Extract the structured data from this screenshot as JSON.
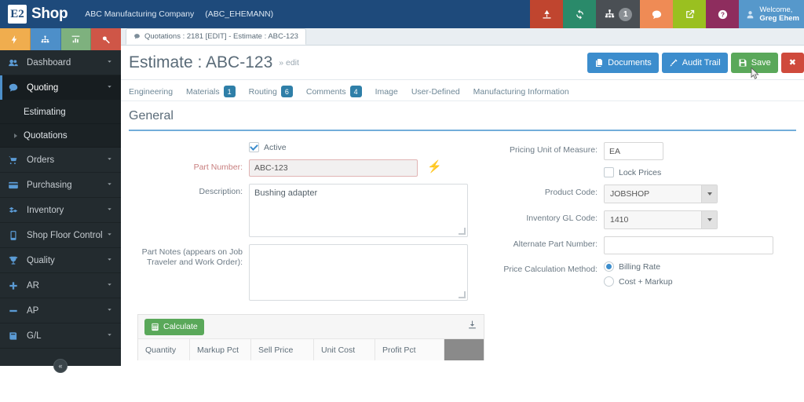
{
  "header": {
    "brand_mark": "E2",
    "brand_name": "Shop",
    "company_name": "ABC Manufacturing Company",
    "company_code": "(ABC_EHEMANN)",
    "welcome_line1": "Welcome,",
    "welcome_line2": "Greg Ehem",
    "actions": [
      {
        "name": "alerts-icon",
        "color": "#c0452f"
      },
      {
        "name": "sync-icon",
        "color": "#2a8a6a"
      },
      {
        "name": "org-chart-icon",
        "color": "#4a4f54",
        "badge": "1"
      },
      {
        "name": "chat-icon",
        "color": "#ef8b55"
      },
      {
        "name": "launch-icon",
        "color": "#9ac020"
      },
      {
        "name": "help-icon",
        "color": "#8e2d5e"
      }
    ]
  },
  "sidebar": {
    "quick_actions": [
      {
        "name": "bolt-icon",
        "color": "#f0ad4e"
      },
      {
        "name": "sitemap-icon",
        "color": "#4d8fc9"
      },
      {
        "name": "chart-icon",
        "color": "#7eb17e"
      },
      {
        "name": "tools-icon",
        "color": "#cf5647"
      }
    ],
    "items": [
      {
        "label": "Dashboard",
        "icon": "dashboard-icon",
        "active": false
      },
      {
        "label": "Quoting",
        "icon": "quoting-icon",
        "active": true
      },
      {
        "label": "Orders",
        "icon": "cart-icon",
        "active": false
      },
      {
        "label": "Purchasing",
        "icon": "card-icon",
        "active": false
      },
      {
        "label": "Inventory",
        "icon": "boxes-icon",
        "active": false
      },
      {
        "label": "Shop Floor Control",
        "icon": "tablet-icon",
        "active": false
      },
      {
        "label": "Quality",
        "icon": "trophy-icon",
        "active": false
      },
      {
        "label": "AR",
        "icon": "plus-icon",
        "active": false
      },
      {
        "label": "AP",
        "icon": "minus-icon",
        "active": false
      },
      {
        "label": "G/L",
        "icon": "book-icon",
        "active": false
      }
    ],
    "sub_items": [
      {
        "label": "Estimating",
        "has_caret": false
      },
      {
        "label": "Quotations",
        "has_caret": true
      }
    ],
    "collapse_glyph": "«"
  },
  "document_tab": {
    "label": "Quotations : 2181 [EDIT] - Estimate : ABC-123"
  },
  "page": {
    "title": "Estimate : ABC-123",
    "edit_suffix": "» edit",
    "actions": [
      {
        "label": "Documents",
        "icon": "documents-icon",
        "style": "blue"
      },
      {
        "label": "Audit Trail",
        "icon": "audit-icon",
        "style": "blue"
      },
      {
        "label": "Save",
        "icon": "save-icon",
        "style": "green"
      },
      {
        "label": "✖",
        "icon": "close-icon",
        "style": "red"
      }
    ]
  },
  "subtabs": [
    {
      "label": "Engineering",
      "badge": null
    },
    {
      "label": "Materials",
      "badge": "1"
    },
    {
      "label": "Routing",
      "badge": "6"
    },
    {
      "label": "Comments",
      "badge": "4"
    },
    {
      "label": "Image",
      "badge": null
    },
    {
      "label": "User-Defined",
      "badge": null
    },
    {
      "label": "Manufacturing Information",
      "badge": null
    }
  ],
  "section": {
    "title": "General"
  },
  "form_left": {
    "active_label": "Active",
    "active_checked": true,
    "part_number_label": "Part Number:",
    "part_number_value": "ABC-123",
    "description_label": "Description:",
    "description_value": "Bushing adapter",
    "part_notes_label": "Part Notes (appears on Job Traveler and Work Order):",
    "part_notes_value": ""
  },
  "form_right": {
    "pricing_uom_label": "Pricing Unit of Measure:",
    "pricing_uom_value": "EA",
    "lock_prices_label": "Lock Prices",
    "lock_prices_checked": false,
    "product_code_label": "Product Code:",
    "product_code_value": "JOBSHOP",
    "inventory_gl_label": "Inventory GL Code:",
    "inventory_gl_value": "1410",
    "alternate_part_label": "Alternate Part Number:",
    "alternate_part_value": "",
    "price_calc_label": "Price Calculation Method:",
    "price_calc_options": [
      {
        "label": "Billing Rate",
        "selected": true
      },
      {
        "label": "Cost + Markup",
        "selected": false
      }
    ]
  },
  "calc_panel": {
    "calculate_label": "Calculate",
    "download_icon": "download-icon",
    "columns": [
      "Quantity",
      "Markup Pct",
      "Sell Price",
      "Unit Cost",
      "Profit Pct"
    ]
  },
  "colors": {
    "header_bg": "#1e4a7b",
    "sidebar_bg": "#232b2f",
    "accent_blue": "#3c8dcd",
    "accent_green": "#5aa85a",
    "accent_red": "#cf4a3c",
    "badge_blue": "#2f7fa8"
  }
}
